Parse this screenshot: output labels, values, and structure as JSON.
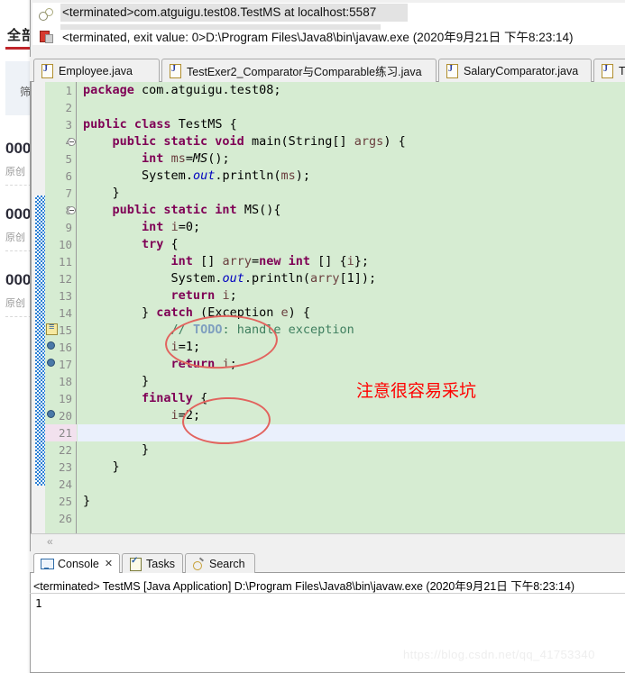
{
  "background_page": {
    "nav_title": "全部",
    "filter_label": "筛选",
    "articles": [
      {
        "title": "000",
        "meta": "原创"
      },
      {
        "title": "000",
        "meta": "原创"
      },
      {
        "title": "000",
        "meta": "原创"
      }
    ]
  },
  "popup": {
    "line1": "<terminated>com.atguigu.test08.TestMS at localhost:5587",
    "line1_icon": "debug-launch-icon",
    "line2": "<terminated, exit value: 0>D:\\Program Files\\Java8\\bin\\javaw.exe (2020年9月21日 下午8:23:14)",
    "line2_icon": "terminated-process-icon"
  },
  "editor_tabs": [
    {
      "label": "Employee.java",
      "icon": "java-file-icon",
      "active": false
    },
    {
      "label": "TestExer2_Comparator与Comparable练习.java",
      "icon": "java-file-icon",
      "active": false
    },
    {
      "label": "SalaryComparator.java",
      "icon": "java-file-icon",
      "active": false
    },
    {
      "label": "T",
      "icon": "java-file-icon",
      "active": false
    }
  ],
  "editor": {
    "current_line": 21,
    "background_color": "#d6ecd2",
    "lines": [
      {
        "n": 1,
        "text": "package com.atguigu.test08;"
      },
      {
        "n": 2,
        "text": ""
      },
      {
        "n": 3,
        "text": "public class TestMS {"
      },
      {
        "n": 4,
        "text": "    public static void main(String[] args) {"
      },
      {
        "n": 5,
        "text": "        int ms=MS();"
      },
      {
        "n": 6,
        "text": "        System.out.println(ms);"
      },
      {
        "n": 7,
        "text": "    }"
      },
      {
        "n": 8,
        "text": "    public static int MS(){"
      },
      {
        "n": 9,
        "text": "        int i=0;"
      },
      {
        "n": 10,
        "text": "        try {"
      },
      {
        "n": 11,
        "text": "            int [] arry=new int [] {i};"
      },
      {
        "n": 12,
        "text": "            System.out.println(arry[1]);"
      },
      {
        "n": 13,
        "text": "            return i;"
      },
      {
        "n": 14,
        "text": "        } catch (Exception e) {"
      },
      {
        "n": 15,
        "text": "            // TODO: handle exception"
      },
      {
        "n": 16,
        "text": "            i=1;"
      },
      {
        "n": 17,
        "text": "            return i;"
      },
      {
        "n": 18,
        "text": "        }"
      },
      {
        "n": 19,
        "text": "        finally {"
      },
      {
        "n": 20,
        "text": "            i=2;"
      },
      {
        "n": 21,
        "text": ""
      },
      {
        "n": 22,
        "text": "        }"
      },
      {
        "n": 23,
        "text": "    }"
      },
      {
        "n": 24,
        "text": ""
      },
      {
        "n": 25,
        "text": "}"
      },
      {
        "n": 26,
        "text": ""
      }
    ]
  },
  "annotations": {
    "note_text": "注意很容易采坑",
    "note_color": "#ff0000",
    "ellipse_color": "#e2635e",
    "ellipse_count": 2
  },
  "console": {
    "tabs": [
      {
        "label": "Console",
        "icon": "console-icon",
        "active": true,
        "closable": true
      },
      {
        "label": "Tasks",
        "icon": "tasks-icon",
        "active": false,
        "closable": false
      },
      {
        "label": "Search",
        "icon": "search-icon",
        "active": false,
        "closable": false
      }
    ],
    "header": "<terminated> TestMS [Java Application] D:\\Program Files\\Java8\\bin\\javaw.exe (2020年9月21日 下午8:23:14)",
    "output": "1"
  },
  "watermark": "https://blog.csdn.net/qq_41753340"
}
